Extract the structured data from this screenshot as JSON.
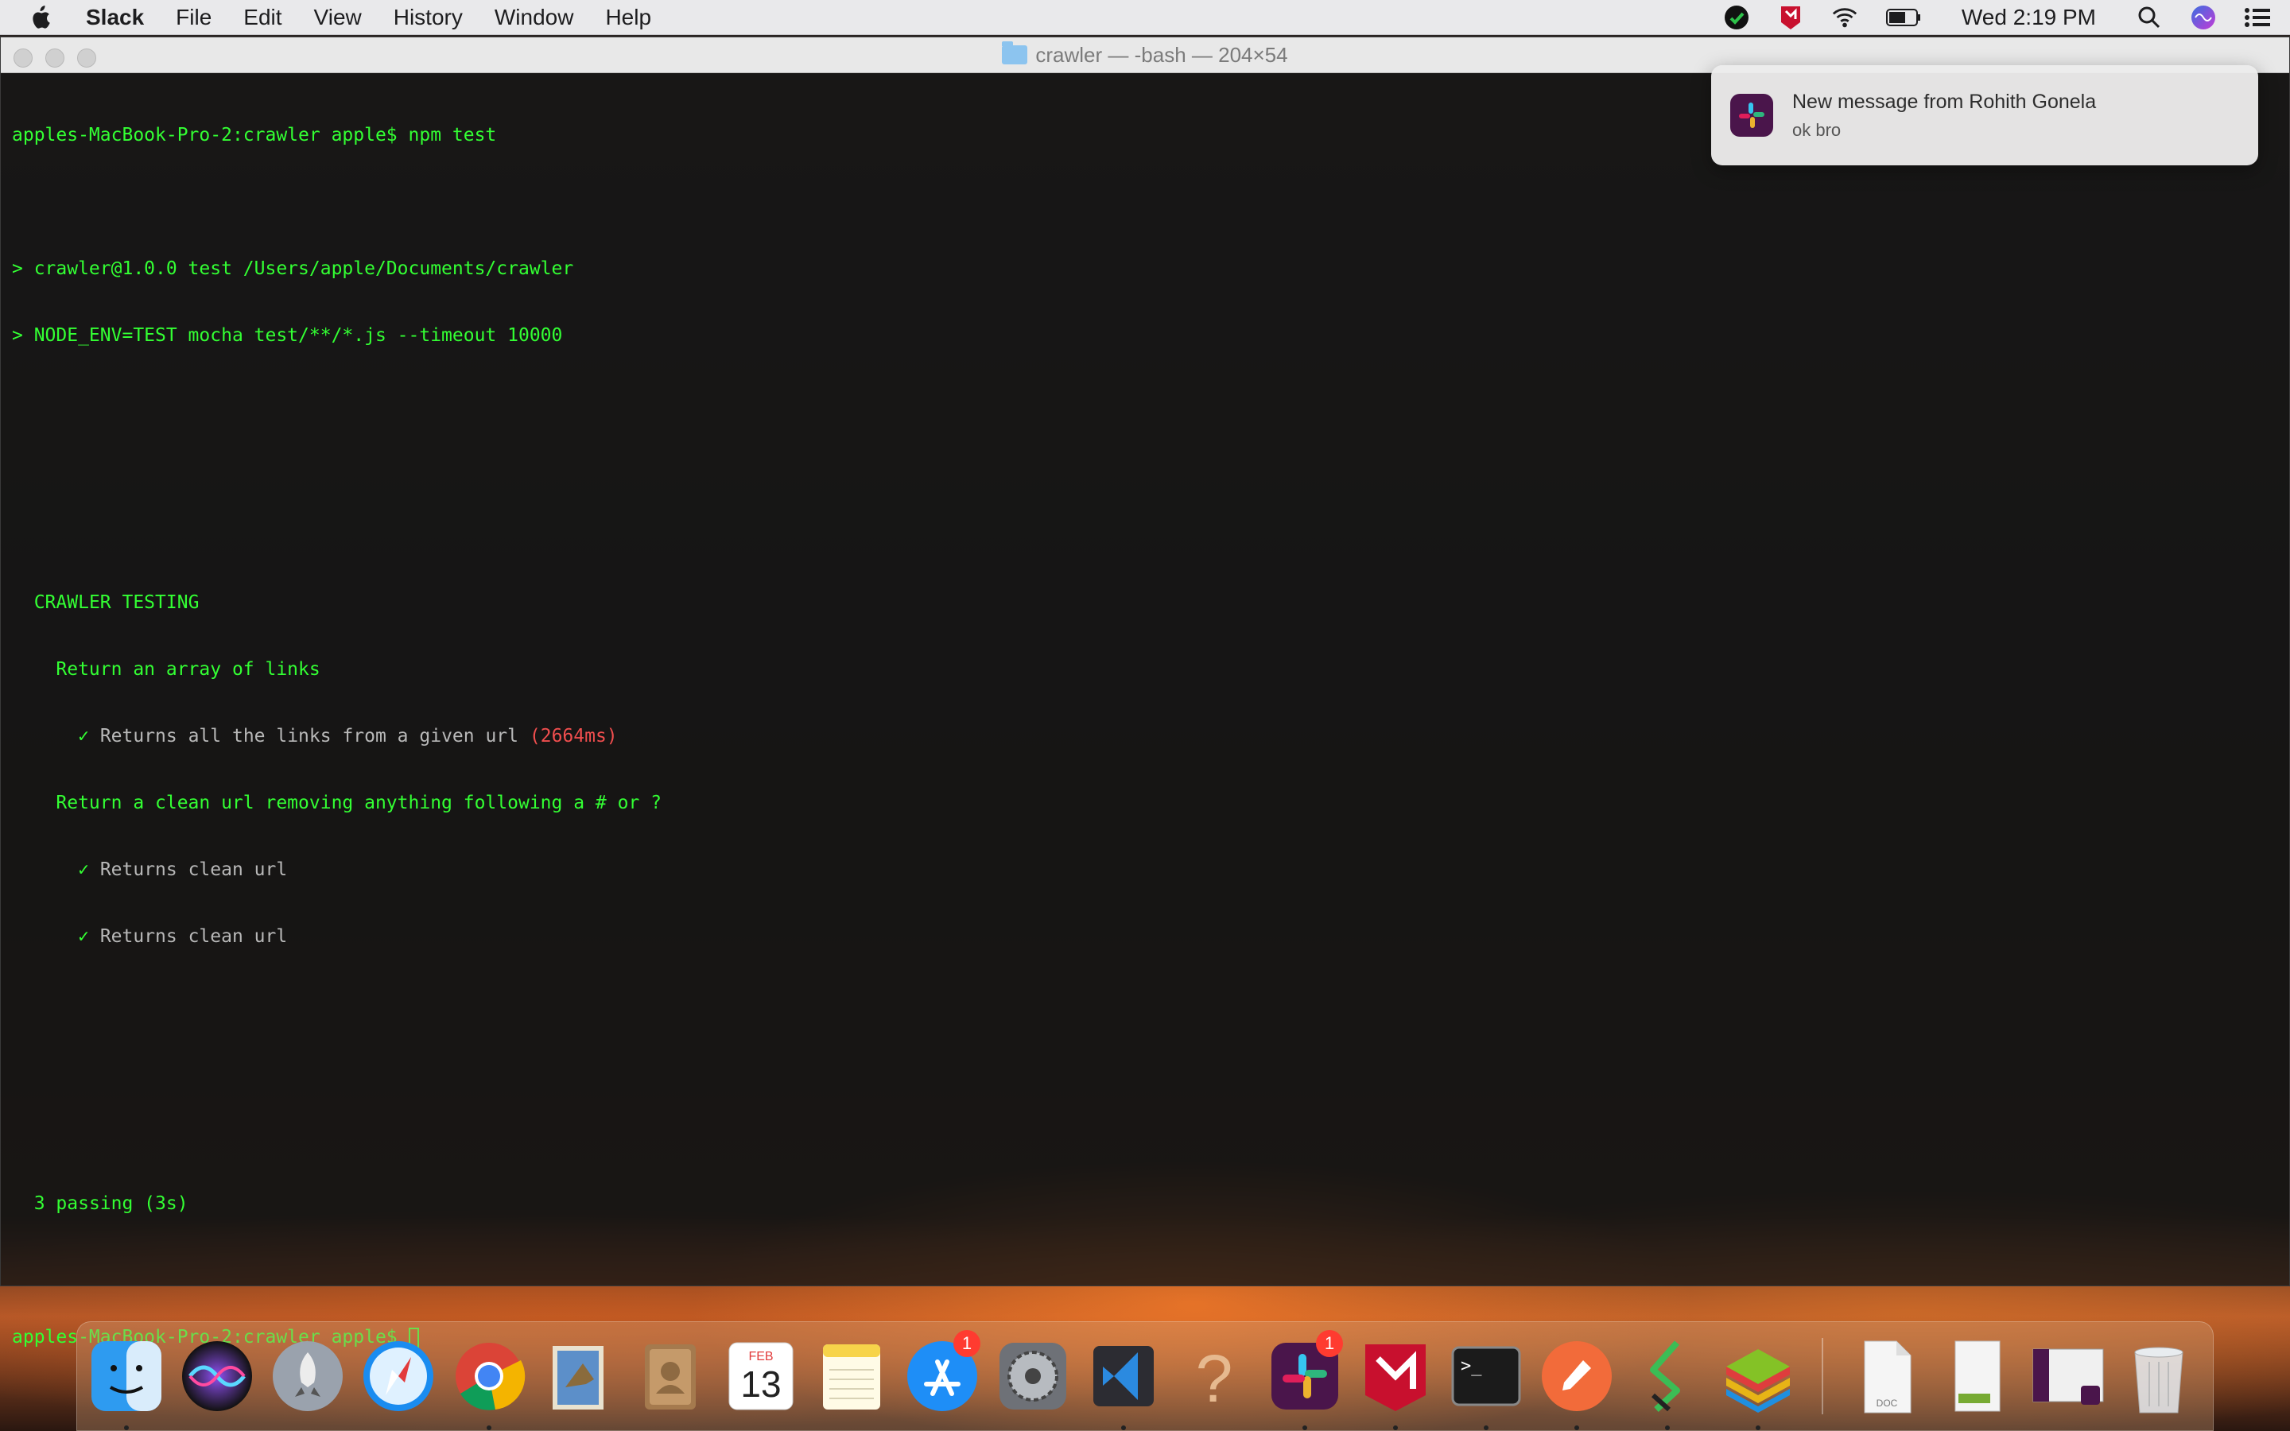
{
  "menubar": {
    "app_name": "Slack",
    "menus": [
      "File",
      "Edit",
      "View",
      "History",
      "Window",
      "Help"
    ],
    "clock": "Wed 2:19 PM",
    "status_icons": [
      "wechat-icon",
      "mcafee-icon",
      "wifi-icon",
      "battery-icon",
      "search-icon",
      "siri-icon",
      "notification-center-icon"
    ]
  },
  "terminal": {
    "title": "crawler — -bash — 204×54",
    "lines": {
      "l1": "apples-MacBook-Pro-2:crawler apple$ npm test",
      "l2": "> crawler@1.0.0 test /Users/apple/Documents/crawler",
      "l3": "> NODE_ENV=TEST mocha test/**/*.js --timeout 10000",
      "suite": "CRAWLER TESTING",
      "group1": "Return an array of links",
      "test1": "Returns all the links from a given url",
      "test1_time": "(2664ms)",
      "group2": "Return a clean url removing anything following a # or ?",
      "test2": "Returns clean url",
      "test3": "Returns clean url",
      "check": "✓",
      "summary": "3 passing (3s)",
      "prompt": "apples-MacBook-Pro-2:crawler apple$ "
    }
  },
  "notification": {
    "title": "New message from Rohith Gonela",
    "body": "ok bro",
    "app_icon": "slack-icon"
  },
  "dock": {
    "calendar_month": "FEB",
    "calendar_day": "13",
    "appstore_badge": "1",
    "slack_badge": "1",
    "doc_label": "DOC",
    "help_glyph": "?",
    "terminal_glyph": ">_",
    "items": [
      "Finder",
      "Siri",
      "Launchpad",
      "Safari",
      "Google Chrome",
      "Mail",
      "Contacts",
      "Calendar",
      "Notes",
      "App Store",
      "System Preferences",
      "Visual Studio Code",
      "Help",
      "Slack",
      "McAfee",
      "Terminal",
      "Postman",
      "Sublime Merge",
      "BlueStacks",
      "Document",
      "Screenshot",
      "Screenshot 2",
      "Trash"
    ]
  },
  "colors": {
    "terminal_green": "#33ff33",
    "error_red": "#f04e4e",
    "badge_red": "#ff3b30",
    "slack_purple": "#4a154b"
  }
}
